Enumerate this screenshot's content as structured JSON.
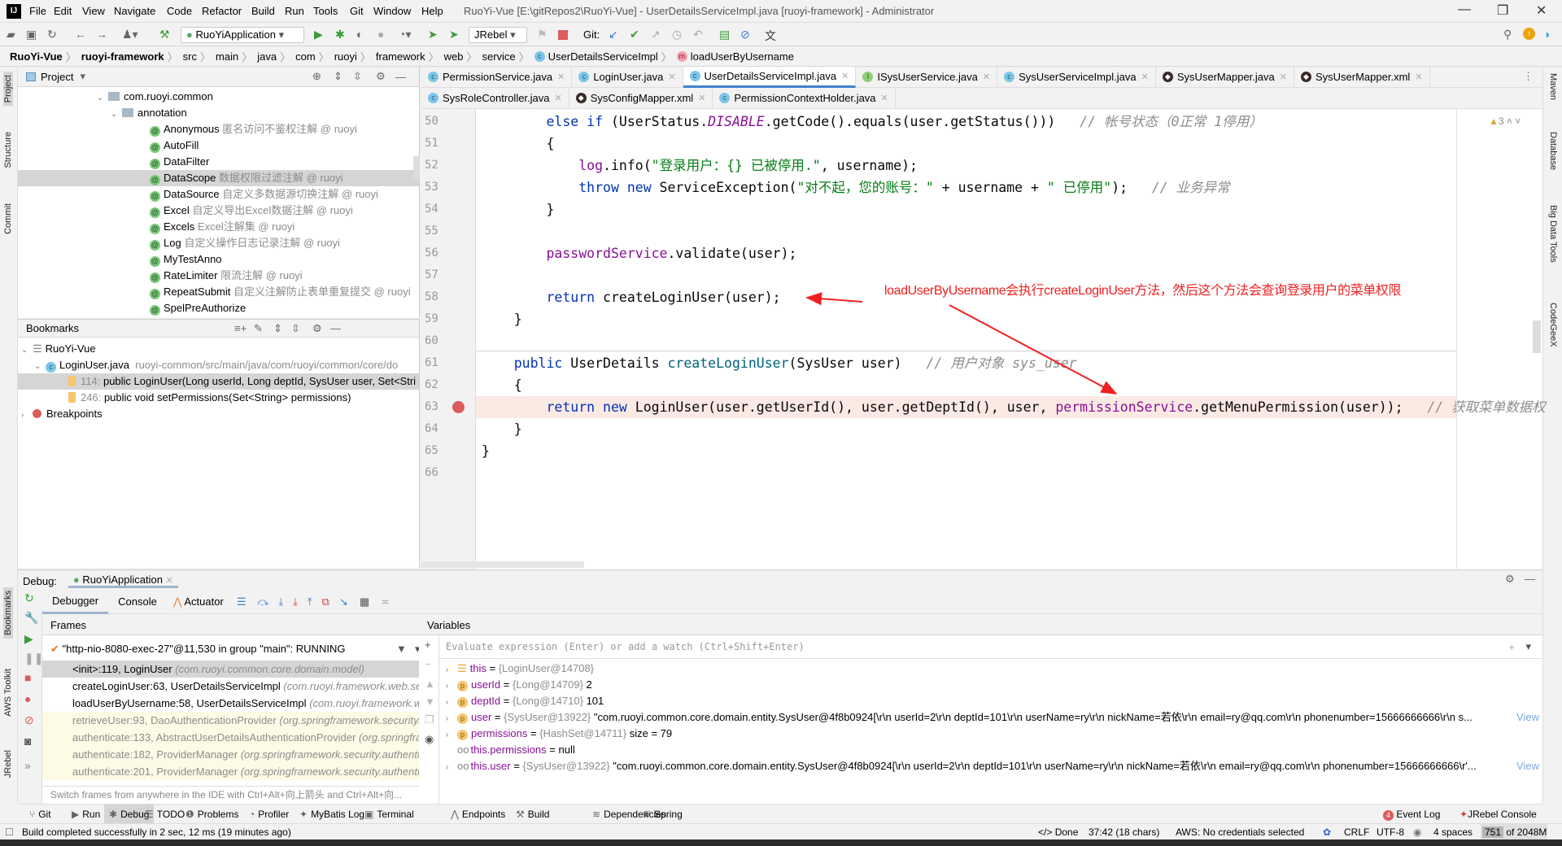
{
  "app": {
    "title": "RuoYi-Vue [E:\\gitRepos2\\RuoYi-Vue] - UserDetailsServiceImpl.java [ruoyi-framework] - Administrator",
    "logo": "IJ",
    "menu": [
      "File",
      "Edit",
      "View",
      "Navigate",
      "Code",
      "Refactor",
      "Build",
      "Run",
      "Tools",
      "Git",
      "Window",
      "Help"
    ]
  },
  "toolbar": {
    "run_config": "RuoYiApplication",
    "jrebel_config": "JRebel",
    "git_label": "Git:"
  },
  "breadcrumb": [
    "RuoYi-Vue",
    "ruoyi-framework",
    "src",
    "main",
    "java",
    "com",
    "ruoyi",
    "framework",
    "web",
    "service",
    "UserDetailsServiceImpl",
    "loadUserByUsername"
  ],
  "left_strip": [
    "Project",
    "Structure",
    "Commit",
    "Bookmarks",
    "AWS Toolkit",
    "JRebel"
  ],
  "right_strip": [
    "Maven",
    "Database",
    "Big Data Tools",
    "CodeGeeX"
  ],
  "project": {
    "title": "Project",
    "tree": [
      {
        "name": "com.ruoyi.common",
        "type": "package",
        "depth": 0
      },
      {
        "name": "annotation",
        "type": "package",
        "depth": 1
      },
      {
        "name": "Anonymous",
        "hint": "匿名访问不鉴权注解 @ ruoyi",
        "type": "annotation"
      },
      {
        "name": "AutoFill",
        "hint": "",
        "type": "annotation"
      },
      {
        "name": "DataFilter",
        "hint": "",
        "type": "annotation"
      },
      {
        "name": "DataScope",
        "hint": "数据权限过滤注解 @ ruoyi",
        "type": "annotation",
        "selected": true
      },
      {
        "name": "DataSource",
        "hint": "自定义多数据源切换注解 @ ruoyi",
        "type": "annotation"
      },
      {
        "name": "Excel",
        "hint": "自定义导出Excel数据注解 @ ruoyi",
        "type": "annotation"
      },
      {
        "name": "Excels",
        "hint": "Excel注解集 @ ruoyi",
        "type": "annotation"
      },
      {
        "name": "Log",
        "hint": "自定义操作日志记录注解 @ ruoyi",
        "type": "annotation"
      },
      {
        "name": "MyTestAnno",
        "hint": "",
        "type": "annotation"
      },
      {
        "name": "RateLimiter",
        "hint": "限流注解 @ ruoyi",
        "type": "annotation"
      },
      {
        "name": "RepeatSubmit",
        "hint": "自定义注解防止表单重复提交 @ ruoyi",
        "type": "annotation"
      },
      {
        "name": "SpelPreAuthorize",
        "hint": "",
        "type": "annotation"
      }
    ]
  },
  "bookmarks": {
    "title": "Bookmarks",
    "root": "RuoYi-Vue",
    "file": "LoginUser.java",
    "file_path": "ruoyi-common/src/main/java/com/ruoyi/common/core/do",
    "items": [
      {
        "line": "114:",
        "text": "public LoginUser(Long userId, Long deptId, SysUser user, Set<Stri"
      },
      {
        "line": "246:",
        "text": "public void setPermissions(Set<String> permissions)"
      }
    ],
    "breakpoints": "Breakpoints"
  },
  "editor": {
    "tabs_row1": [
      {
        "label": "PermissionService.java",
        "icon": "c"
      },
      {
        "label": "LoginUser.java",
        "icon": "c"
      },
      {
        "label": "UserDetailsServiceImpl.java",
        "icon": "c",
        "active": true
      },
      {
        "label": "ISysUserService.java",
        "icon": "i"
      },
      {
        "label": "SysUserServiceImpl.java",
        "icon": "c"
      },
      {
        "label": "SysUserMapper.java",
        "icon": "m"
      },
      {
        "label": "SysUserMapper.xml",
        "icon": "m"
      }
    ],
    "tabs_row2": [
      {
        "label": "SysRoleController.java",
        "icon": "c"
      },
      {
        "label": "SysConfigMapper.xml",
        "icon": "m"
      },
      {
        "label": "PermissionContextHolder.java",
        "icon": "c"
      }
    ],
    "warnings": "3",
    "current_line": 63,
    "lines": [
      {
        "n": "50",
        "tokens": [
          [
            "        ",
            ""
          ],
          [
            "else if",
            "kw"
          ],
          [
            " (UserStatus.",
            ""
          ],
          [
            "DISABLE",
            "static"
          ],
          [
            ".getCode().equals(user.getStatus()))   ",
            ""
          ],
          [
            "// 帐号状态（0正常 1停用）",
            "cmt"
          ]
        ]
      },
      {
        "n": "51",
        "tokens": [
          [
            "        {",
            ""
          ]
        ]
      },
      {
        "n": "52",
        "tokens": [
          [
            "            ",
            ""
          ],
          [
            "log",
            "field"
          ],
          [
            ".info(",
            ""
          ],
          [
            "\"登录用户：{} 已被停用.\"",
            "str"
          ],
          [
            ", username);",
            ""
          ]
        ]
      },
      {
        "n": "53",
        "tokens": [
          [
            "            ",
            ""
          ],
          [
            "throw new",
            "kw"
          ],
          [
            " ServiceException(",
            ""
          ],
          [
            "\"对不起，您的账号：\"",
            "str"
          ],
          [
            " + username + ",
            ""
          ],
          [
            "\" 已停用\"",
            "str"
          ],
          [
            ");   ",
            ""
          ],
          [
            "// 业务异常",
            "cmt"
          ]
        ]
      },
      {
        "n": "54",
        "tokens": [
          [
            "        }",
            ""
          ]
        ]
      },
      {
        "n": "55",
        "tokens": []
      },
      {
        "n": "56",
        "tokens": [
          [
            "        ",
            ""
          ],
          [
            "passwordService",
            "field"
          ],
          [
            ".validate(user);",
            ""
          ]
        ]
      },
      {
        "n": "57",
        "tokens": []
      },
      {
        "n": "58",
        "tokens": [
          [
            "        ",
            ""
          ],
          [
            "return",
            "kw"
          ],
          [
            " createLoginUser(user);",
            ""
          ]
        ]
      },
      {
        "n": "59",
        "tokens": [
          [
            "    }",
            ""
          ]
        ]
      },
      {
        "n": "60",
        "tokens": []
      },
      {
        "n": "61",
        "tokens": [
          [
            "    ",
            ""
          ],
          [
            "public",
            "kw"
          ],
          [
            " UserDetails ",
            ""
          ],
          [
            "createLoginUser",
            "fn"
          ],
          [
            "(SysUser user)   ",
            ""
          ],
          [
            "// 用户对象 sys_user",
            "cmt"
          ]
        ]
      },
      {
        "n": "62",
        "tokens": [
          [
            "    {",
            ""
          ]
        ]
      },
      {
        "n": "63",
        "tokens": [
          [
            "        ",
            ""
          ],
          [
            "return new",
            "kw"
          ],
          [
            " LoginUser(user.getUserId(), user.getDeptId(), user, ",
            ""
          ],
          [
            "permissionService",
            "field"
          ],
          [
            ".getMenuPermission(user));   ",
            ""
          ],
          [
            "// 获取菜单数据权",
            "cmt"
          ]
        ]
      },
      {
        "n": "64",
        "tokens": [
          [
            "    }",
            ""
          ]
        ]
      },
      {
        "n": "65",
        "tokens": [
          [
            "}",
            ""
          ]
        ]
      },
      {
        "n": "66",
        "tokens": []
      }
    ],
    "annotation": "loadUserByUsername会执行createLoginUser方法，然后这个方法会查询登录用户的菜单权限",
    "annotation_color": "#f02020"
  },
  "debug": {
    "label": "Debug:",
    "session": "RuoYiApplication",
    "tabs": [
      "Debugger",
      "Console",
      "Actuator"
    ],
    "frames_title": "Frames",
    "variables_title": "Variables",
    "thread": "\"http-nio-8080-exec-27\"@11,530 in group \"main\": RUNNING",
    "frames": [
      {
        "m": "<init>:119, LoginUser",
        "p": "(com.ruoyi.common.core.domain.model)",
        "kind": "sel"
      },
      {
        "m": "createLoginUser:63, UserDetailsServiceImpl",
        "p": "(com.ruoyi.framework.web.servic",
        "kind": ""
      },
      {
        "m": "loadUserByUsername:58, UserDetailsServiceImpl",
        "p": "(com.ruoyi.framework.web.s",
        "kind": ""
      },
      {
        "m": "retrieveUser:93, DaoAuthenticationProvider",
        "p": "(org.springframework.security.au",
        "kind": "lib"
      },
      {
        "m": "authenticate:133, AbstractUserDetailsAuthenticationProvider",
        "p": "(org.springframe",
        "kind": "lib"
      },
      {
        "m": "authenticate:182, ProviderManager",
        "p": "(org.springframework.security.authentica",
        "kind": "lib"
      },
      {
        "m": "authenticate:201, ProviderManager",
        "p": "(org.springframework.security.authentica",
        "kind": "lib"
      }
    ],
    "frames_tip": "Switch frames from anywhere in the IDE with Ctrl+Alt+向上箭头 and Ctrl+Alt+向...",
    "eval_placeholder": "Evaluate expression (Enter) or add a watch (Ctrl+Shift+Enter)",
    "variables": [
      {
        "icon": "field-list",
        "name": "this",
        "type": "{LoginUser@14708}",
        "value": "",
        "expandable": true
      },
      {
        "icon": "p",
        "name": "userId",
        "type": "{Long@14709}",
        "value": "2",
        "expandable": true
      },
      {
        "icon": "p",
        "name": "deptId",
        "type": "{Long@14710}",
        "value": "101",
        "expandable": true
      },
      {
        "icon": "p",
        "name": "user",
        "type": "{SysUser@13922}",
        "value": "\"com.ruoyi.common.core.domain.entity.SysUser@4f8b0924[\\r\\n  userId=2\\r\\n  deptId=101\\r\\n  userName=ry\\r\\n  nickName=若依\\r\\n  email=ry@qq.com\\r\\n  phonenumber=15666666666\\r\\n  s...",
        "link": "View",
        "expandable": true
      },
      {
        "icon": "p",
        "name": "permissions",
        "type": "{HashSet@14711}",
        "value": " size = 79",
        "expandable": true
      },
      {
        "icon": "watch",
        "name": "this.permissions",
        "type": "",
        "value": "null",
        "expandable": false
      },
      {
        "icon": "watch",
        "name": "this.user",
        "type": "{SysUser@13922}",
        "value": "\"com.ruoyi.common.core.domain.entity.SysUser@4f8b0924[\\r\\n  userId=2\\r\\n  deptId=101\\r\\n  userName=ry\\r\\n  nickName=若依\\r\\n  email=ry@qq.com\\r\\n  phonenumber=15666666666\\r'...",
        "link": "View",
        "expandable": true
      }
    ]
  },
  "bottom_tabs": [
    "Git",
    "Run",
    "Debug",
    "TODO",
    "Problems",
    "Profiler",
    "MyBatis Log",
    "Terminal",
    "Endpoints",
    "Build",
    "Dependencies",
    "Spring"
  ],
  "bottom_active": "Debug",
  "bottom_right": {
    "event_log": "Event Log",
    "event_count": "4",
    "jrebel_console": "JRebel Console"
  },
  "status": {
    "message": "Build completed successfully in 2 sec, 12 ms (19 minutes ago)",
    "done": "Done",
    "position": "37:42 (18 chars)",
    "aws": "AWS: No credentials selected",
    "line_sep": "CRLF",
    "encoding": "UTF-8",
    "indent": "4 spaces",
    "memory_used": "751",
    "memory_total": "of 2048M"
  }
}
